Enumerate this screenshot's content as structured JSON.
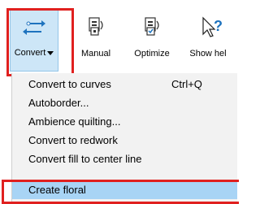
{
  "ribbon": {
    "buttons": [
      {
        "label": "Convert",
        "icon": "convert-arrows-icon"
      },
      {
        "label": "Manual",
        "icon": "manual-digitize-icon"
      },
      {
        "label": "Optimize",
        "icon": "optimize-icon"
      },
      {
        "label": "Show hel",
        "icon": "show-help-cursor-icon"
      }
    ]
  },
  "menu": {
    "items": [
      {
        "label": "Convert to curves",
        "shortcut": "Ctrl+Q"
      },
      {
        "label": "Autoborder..."
      },
      {
        "label": "Ambience quilting..."
      },
      {
        "label": "Convert to redwork"
      },
      {
        "label": "Convert fill to center line"
      },
      {
        "label": "Create floral",
        "selected": true
      }
    ]
  },
  "colors": {
    "highlight_red": "#e0201f",
    "selected_bg": "#a8d4f5",
    "pressed_button_bg": "#cde6f7",
    "icon_blue": "#1e73be"
  }
}
